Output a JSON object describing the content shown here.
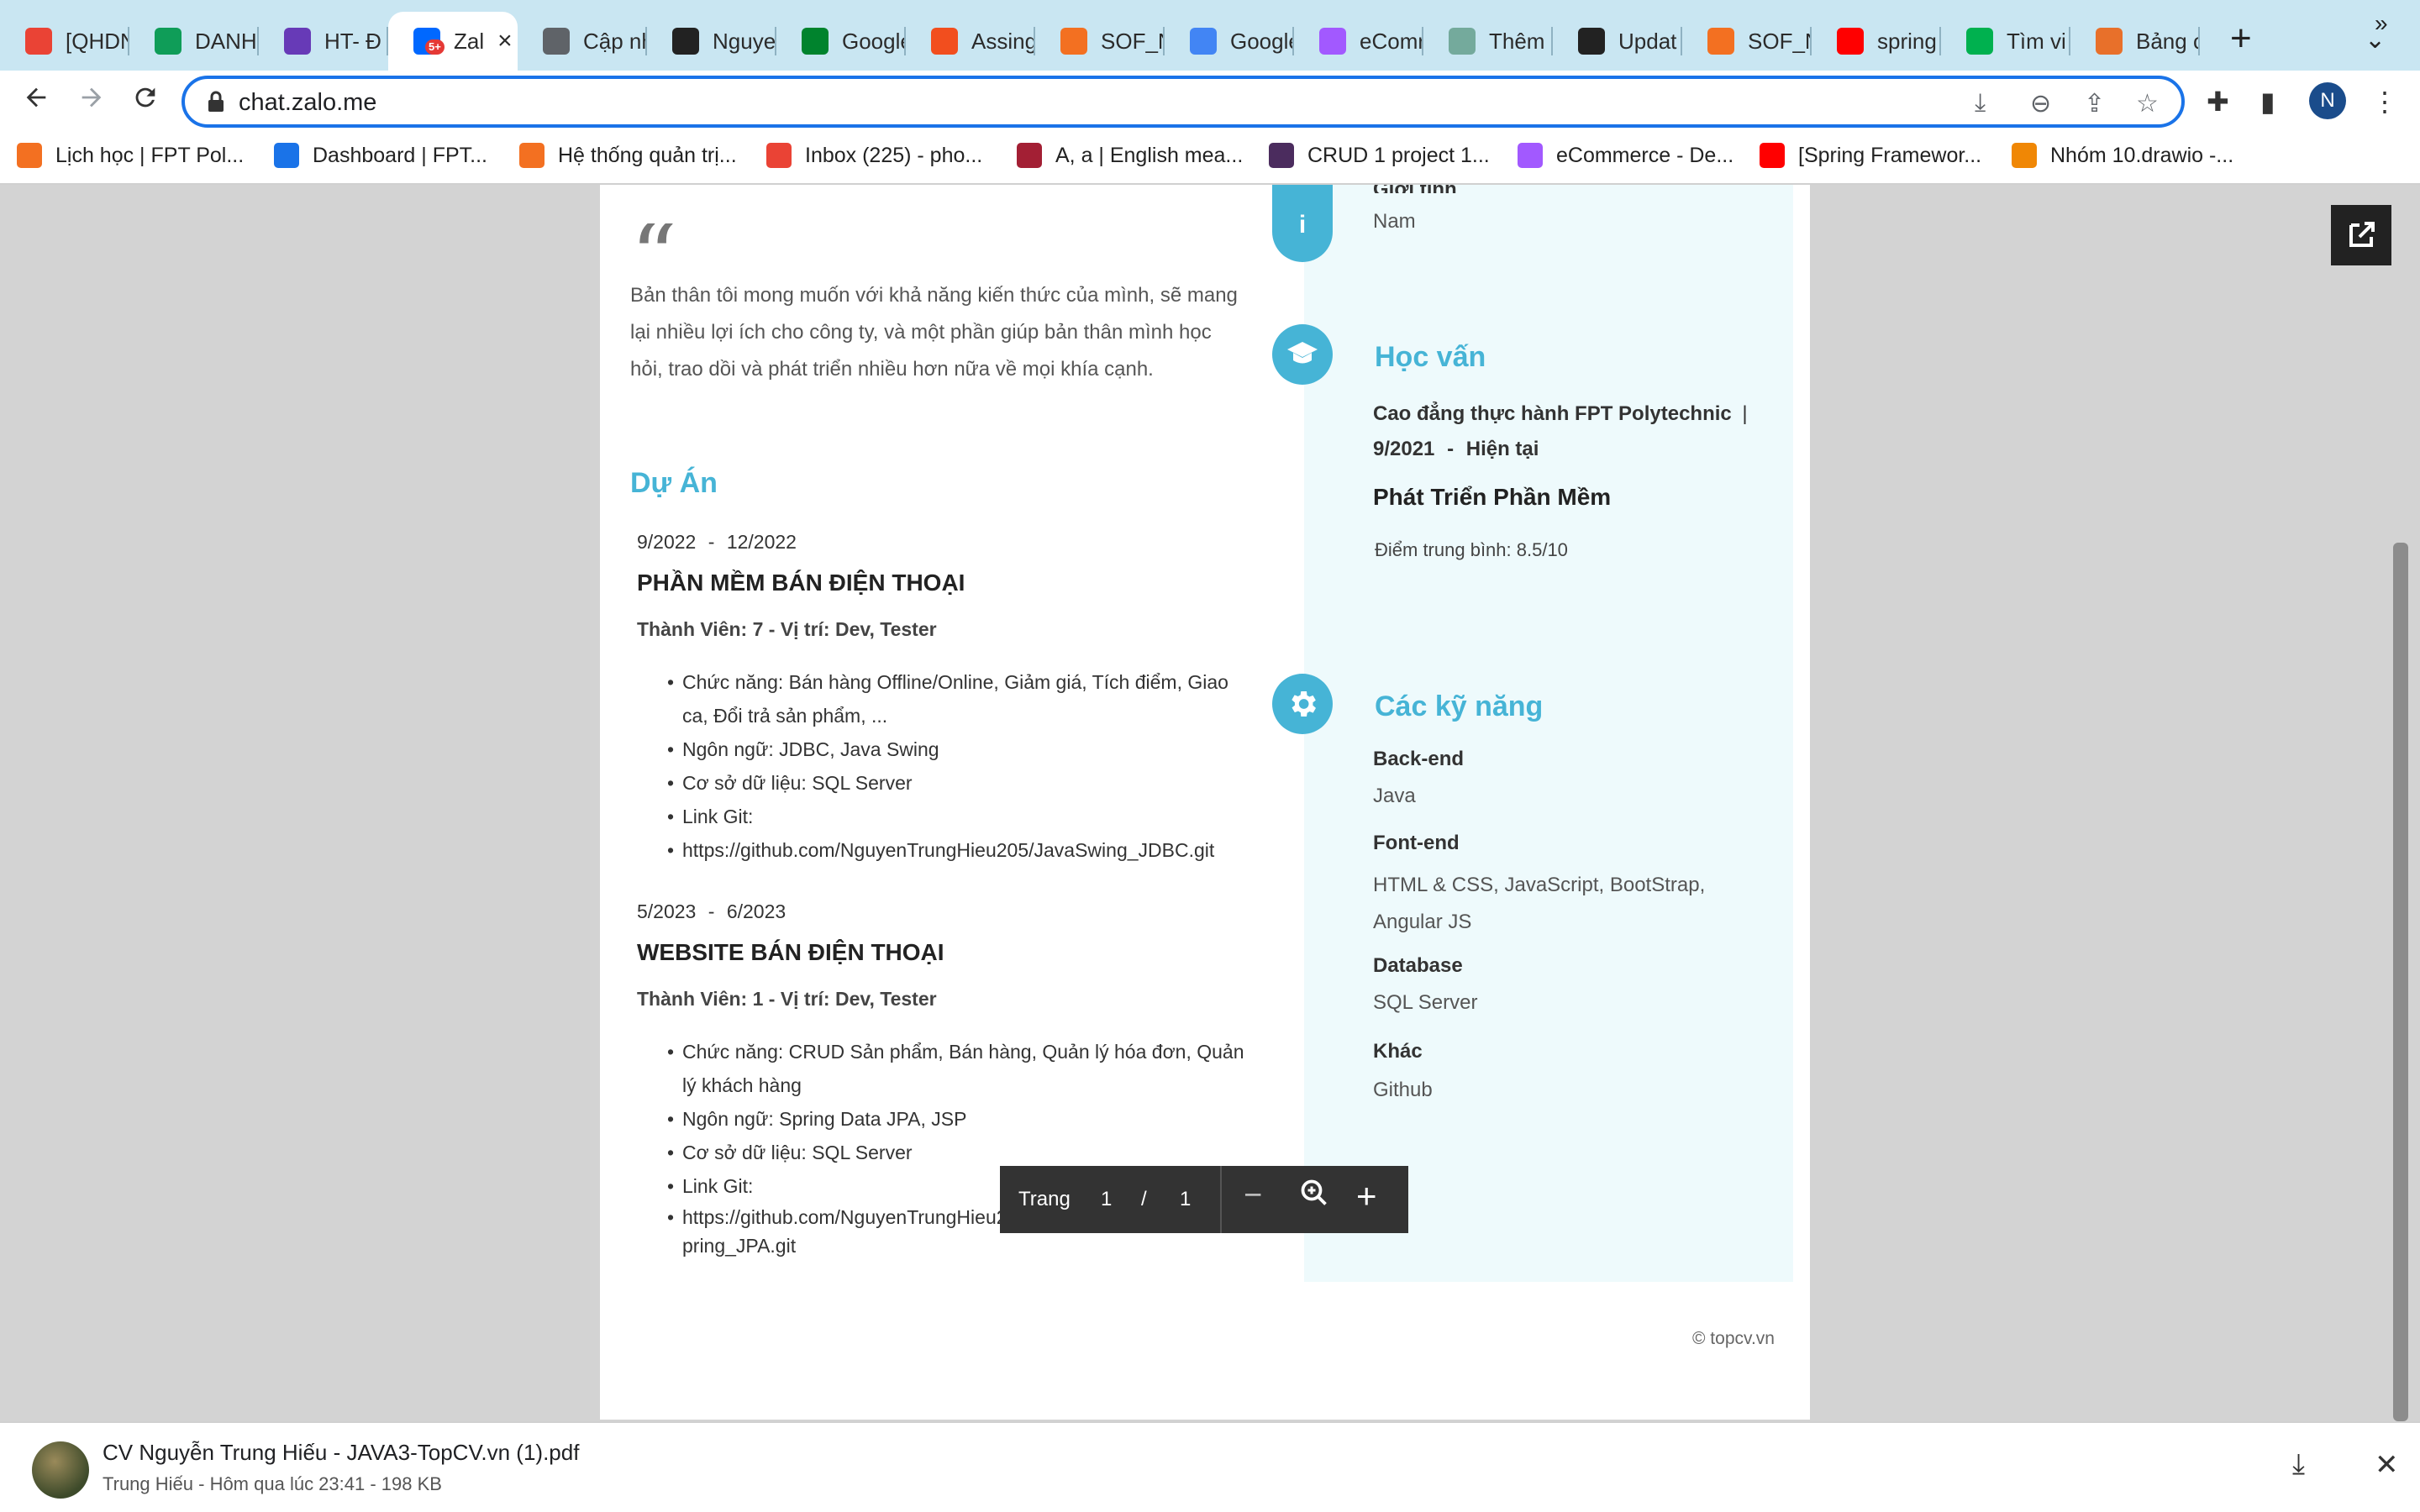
{
  "browser": {
    "tabs": [
      {
        "label": "[QHDN",
        "icon": "gmail-icon",
        "color": "#ea4335"
      },
      {
        "label": "DANH",
        "icon": "sheets-icon",
        "color": "#0f9d58"
      },
      {
        "label": "HT- Đ",
        "icon": "forms-icon",
        "color": "#673ab7"
      },
      {
        "label": "Zal",
        "icon": "zalo-icon",
        "color": "#0068ff",
        "badge": "5+"
      },
      {
        "label": "Cập nh",
        "icon": "globe-icon",
        "color": "#5f6368"
      },
      {
        "label": "Nguye",
        "icon": "github-icon",
        "color": "#222222"
      },
      {
        "label": "Google",
        "icon": "meet-icon",
        "color": "#00832d"
      },
      {
        "label": "Assing",
        "icon": "figma-icon",
        "color": "#f24e1e"
      },
      {
        "label": "SOF_N",
        "icon": "fpt-icon",
        "color": "#f37021"
      },
      {
        "label": "Google",
        "icon": "translate-icon",
        "color": "#4285f4"
      },
      {
        "label": "eComr",
        "icon": "figma-icon",
        "color": "#a259ff"
      },
      {
        "label": "Thêm",
        "icon": "chatgpt-icon",
        "color": "#74aa9c"
      },
      {
        "label": "Updat",
        "icon": "github-icon",
        "color": "#222222"
      },
      {
        "label": "SOF_N",
        "icon": "fpt-icon",
        "color": "#f37021"
      },
      {
        "label": "spring",
        "icon": "youtube-icon",
        "color": "#ff0000"
      },
      {
        "label": "Tìm vi",
        "icon": "topcv-icon",
        "color": "#00b14f"
      },
      {
        "label": "Bảng c",
        "icon": "lms-icon",
        "color": "#e8702a"
      }
    ],
    "url": "chat.zalo.me",
    "profile_initial": "N",
    "bookmarks": [
      {
        "label": "Lịch học | FPT Pol...",
        "color": "#f37021"
      },
      {
        "label": "Dashboard | FPT...",
        "color": "#1a73e8"
      },
      {
        "label": "Hệ thống quản trị...",
        "color": "#f37021"
      },
      {
        "label": "Inbox (225) - pho...",
        "color": "#ea4335"
      },
      {
        "label": "A, a | English mea...",
        "color": "#a31f34"
      },
      {
        "label": "CRUD 1 project 1...",
        "color": "#4b2c5e"
      },
      {
        "label": "eCommerce - De...",
        "color": "#a259ff"
      },
      {
        "label": "[Spring Framewor...",
        "color": "#ff0000"
      },
      {
        "label": "Nhóm 10.drawio -...",
        "color": "#f08705"
      }
    ]
  },
  "cv": {
    "top_gender_label": "Giới tính",
    "top_gender_value": "Nam",
    "summary": "Bản thân tôi mong muốn với khả năng kiến thức của mình, sẽ mang lại nhiều lợi ích cho công ty, và một phần giúp bản thân mình học hỏi, trao dồi và phát triển nhiều hơn nữa về mọi khía cạnh.",
    "projects_heading": "Dự Án",
    "projects": [
      {
        "start": "9/2022",
        "end": "12/2022",
        "title": "PHẦN MỀM BÁN ĐIỆN THOẠI",
        "role": "Thành Viên: 7 - Vị trí: Dev, Tester",
        "bullets": [
          "Chức năng: Bán hàng Offline/Online, Giảm giá, Tích điểm, Giao ca, Đổi trả sản phẩm, ...",
          "Ngôn ngữ: JDBC, Java Swing",
          "Cơ sở dữ liệu: SQL Server",
          "Link Git:",
          "https://github.com/NguyenTrungHieu205/JavaSwing_JDBC.git"
        ]
      },
      {
        "start": "5/2023",
        "end": "6/2023",
        "title": "WEBSITE BÁN ĐIỆN THOẠI",
        "role": "Thành Viên: 1 - Vị trí: Dev, Tester",
        "bullets": [
          "Chức năng: CRUD Sản phẩm, Bán hàng, Quản lý hóa đơn, Quản lý khách hàng",
          "Ngôn ngữ: Spring Data JPA, JSP",
          "Cơ sở dữ liệu: SQL Server",
          "Link Git:",
          "https://github.com/NguyenTrungHieu205/WebsiteBanHang_Java Spring_JPA.git"
        ]
      }
    ],
    "education": {
      "heading": "Học vấn",
      "school": "Cao đẳng thực hành FPT Polytechnic",
      "date_start": "9/2021",
      "date_end": "Hiện tại",
      "major": "Phát Triển Phần Mềm",
      "gpa": "Điểm trung bình: 8.5/10"
    },
    "skills": {
      "heading": "Các kỹ năng",
      "items": [
        {
          "label": "Back-end",
          "value": "Java"
        },
        {
          "label": "Font-end",
          "value": "HTML & CSS, JavaScript, BootStrap, Angular JS"
        },
        {
          "label": "Database",
          "value": "SQL Server"
        },
        {
          "label": "Khác",
          "value": "Github"
        }
      ]
    },
    "footer": "© topcv.vn"
  },
  "pdf_controls": {
    "page_label": "Trang",
    "current_page": "1",
    "separator": "/",
    "total_pages": "1"
  },
  "download": {
    "filename": "CV Nguyễn Trung Hiếu - JAVA3-TopCV.vn (1).pdf",
    "meta": "Trung Hiếu - Hôm qua lúc 23:41 - 198 KB"
  },
  "colors": {
    "accent": "#46b4d6",
    "omnibox_border": "#1a73e8",
    "tabstrip": "#c9e6f2"
  }
}
